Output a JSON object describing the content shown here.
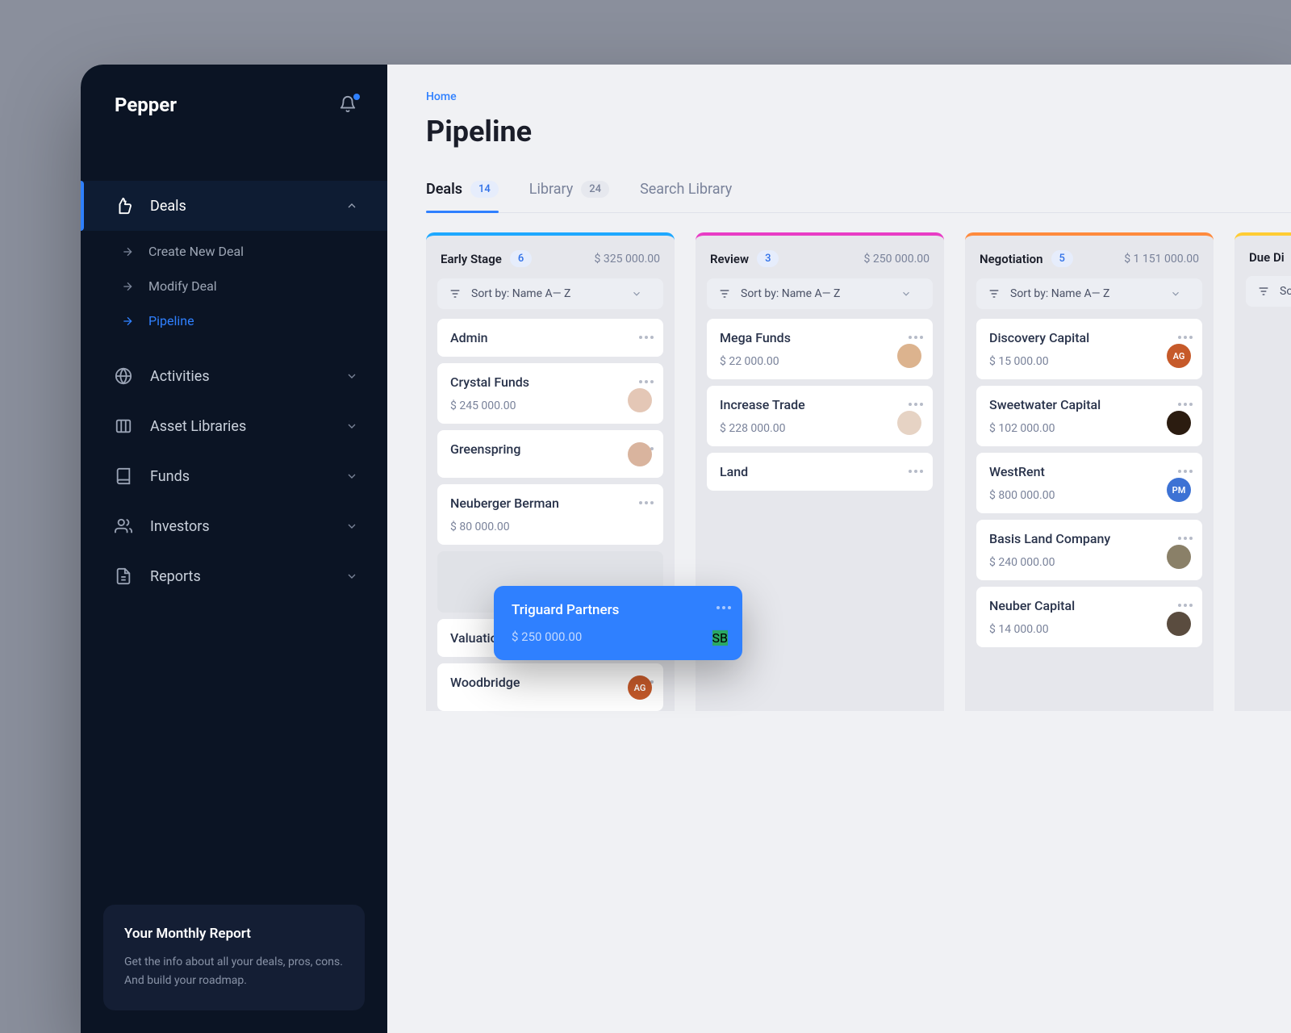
{
  "brand": "Pepper",
  "breadcrumb": "Home",
  "pageTitle": "Pipeline",
  "tabs": [
    {
      "label": "Deals",
      "count": "14",
      "active": true
    },
    {
      "label": "Library",
      "count": "24",
      "active": false
    },
    {
      "label": "Search Library",
      "count": null,
      "active": false
    }
  ],
  "sidebar": {
    "items": [
      {
        "label": "Deals",
        "expanded": true,
        "active": true
      },
      {
        "label": "Activities",
        "expanded": false
      },
      {
        "label": "Asset Libraries",
        "expanded": false
      },
      {
        "label": "Funds",
        "expanded": false
      },
      {
        "label": "Investors",
        "expanded": false
      },
      {
        "label": "Reports",
        "expanded": false
      }
    ],
    "dealsSub": [
      {
        "label": "Create New Deal",
        "active": false
      },
      {
        "label": "Modify Deal",
        "active": false
      },
      {
        "label": "Pipeline",
        "active": true
      }
    ],
    "report": {
      "title": "Your Monthly Report",
      "text": "Get the info about all your deals, pros, cons. And build your roadmap."
    }
  },
  "sortLabel": "Sort by: Name A— Z",
  "columns": [
    {
      "title": "Early Stage",
      "count": "6",
      "total": "$ 325 000.00",
      "color": "#1ea8ff",
      "cards": [
        {
          "title": "Admin",
          "amount": null
        },
        {
          "title": "Crystal Funds",
          "amount": "$ 245 000.00",
          "avatar": "photo",
          "avatarColor": "#e4c7b6"
        },
        {
          "title": "Greenspring",
          "amount": "",
          "avatar": "photo",
          "avatarColor": "#d9b49e"
        },
        {
          "title": "Neuberger Berman",
          "amount": "$ 80 000.00"
        },
        {
          "title": "__PLACEHOLDER__"
        },
        {
          "title": "Valuation Research",
          "amount": null
        },
        {
          "title": "Woodbridge",
          "amount": "",
          "avatar": "AG",
          "avatarColor": "#c65a2a"
        }
      ]
    },
    {
      "title": "Review",
      "count": "3",
      "total": "$ 250 000.00",
      "color": "#e83dc5",
      "cards": [
        {
          "title": "Mega Funds",
          "amount": "$ 22 000.00",
          "avatar": "photo",
          "avatarColor": "#dcb38e"
        },
        {
          "title": "Increase Trade",
          "amount": "$ 228 000.00",
          "avatar": "photo",
          "avatarColor": "#e6d3c4"
        },
        {
          "title": "Land",
          "amount": null
        }
      ]
    },
    {
      "title": "Negotiation",
      "count": "5",
      "total": "$ 1 151 000.00",
      "color": "#ff8a3d",
      "cards": [
        {
          "title": "Discovery Capital",
          "amount": "$ 15 000.00",
          "avatar": "AG",
          "avatarColor": "#c65a2a"
        },
        {
          "title": "Sweetwater Capital",
          "amount": "$ 102 000.00",
          "avatar": "photo",
          "avatarColor": "#2b1c10"
        },
        {
          "title": "WestRent",
          "amount": "$ 800 000.00",
          "avatar": "PM",
          "avatarColor": "#3d72d4"
        },
        {
          "title": "Basis Land Company",
          "amount": "$ 240 000.00",
          "avatar": "photo",
          "avatarColor": "#8a8068"
        },
        {
          "title": "Neuber Capital",
          "amount": "$ 14 000.00",
          "avatar": "photo",
          "avatarColor": "#5a4c3f"
        }
      ]
    },
    {
      "title": "Due Di",
      "count": "",
      "total": "",
      "color": "#ffcc33",
      "cards": []
    }
  ],
  "dragCard": {
    "title": "Triguard Partners",
    "amount": "$ 250 000.00",
    "avatar": "SB",
    "avatarColor": "#2aa864"
  }
}
